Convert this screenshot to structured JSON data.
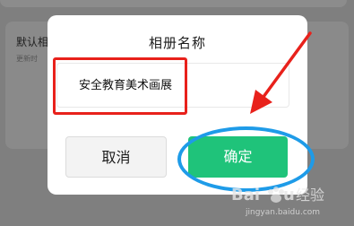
{
  "background": {
    "card_title": "默认相",
    "card_subtitle": "更新时"
  },
  "dialog": {
    "title": "相册名称",
    "name_input": {
      "value": "安全教育美术画展"
    },
    "cancel_label": "取消",
    "confirm_label": "确定"
  },
  "colors": {
    "confirm_button": "#1fc37a",
    "annotation_red": "#e8211b",
    "annotation_blue": "#1e9be8"
  },
  "watermark": {
    "brand": "Baidu经验",
    "url": "jingyan.baidu.com"
  }
}
